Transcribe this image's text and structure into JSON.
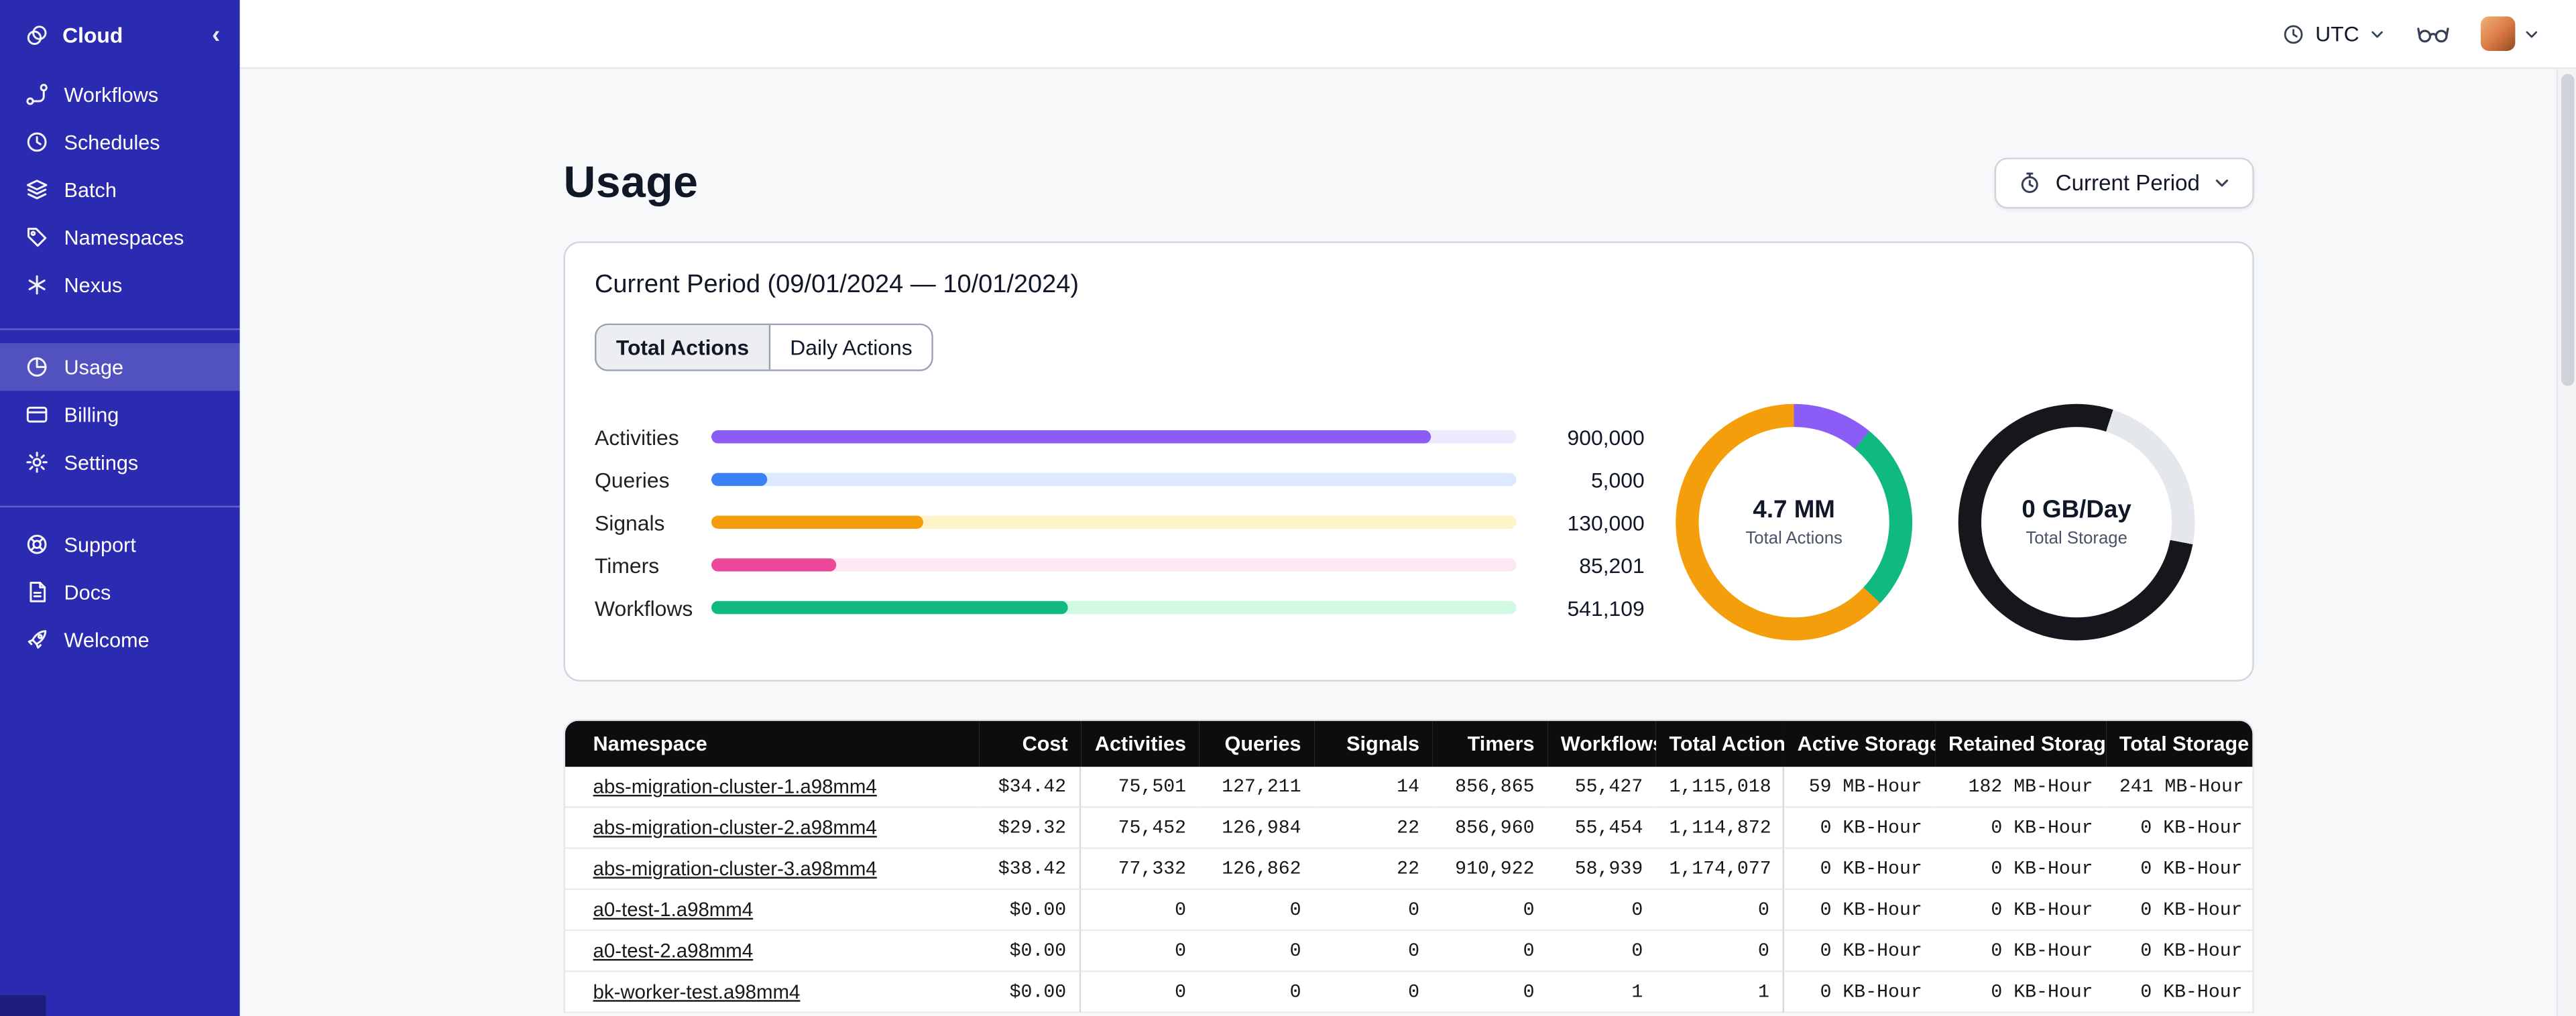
{
  "sidebar": {
    "brand_label": "Cloud",
    "groups": [
      {
        "items": [
          {
            "label": "Workflows",
            "icon": "workflows-icon",
            "active": false
          },
          {
            "label": "Schedules",
            "icon": "schedules-icon",
            "active": false
          },
          {
            "label": "Batch",
            "icon": "batch-icon",
            "active": false
          },
          {
            "label": "Namespaces",
            "icon": "namespaces-icon",
            "active": false
          },
          {
            "label": "Nexus",
            "icon": "nexus-icon",
            "active": false
          }
        ]
      },
      {
        "items": [
          {
            "label": "Usage",
            "icon": "usage-icon",
            "active": true
          },
          {
            "label": "Billing",
            "icon": "billing-icon",
            "active": false
          },
          {
            "label": "Settings",
            "icon": "settings-icon",
            "active": false
          }
        ]
      },
      {
        "items": [
          {
            "label": "Support",
            "icon": "support-icon",
            "active": false
          },
          {
            "label": "Docs",
            "icon": "docs-icon",
            "active": false
          },
          {
            "label": "Welcome",
            "icon": "welcome-icon",
            "active": false
          }
        ]
      }
    ]
  },
  "topbar": {
    "timezone": "UTC"
  },
  "page": {
    "title": "Usage",
    "period_button_label": "Current Period"
  },
  "usage_card": {
    "title": "Current Period (09/01/2024 — 10/01/2024)",
    "tabs": [
      {
        "label": "Total Actions",
        "active": true
      },
      {
        "label": "Daily Actions",
        "active": false
      }
    ],
    "chart_data": {
      "type": "bar",
      "categories": [
        "Activities",
        "Queries",
        "Signals",
        "Timers",
        "Workflows"
      ],
      "values": [
        900000,
        5000,
        130000,
        85201,
        541109
      ],
      "display_values": [
        "900,000",
        "5,000",
        "130,000",
        "85,201",
        "541,109"
      ],
      "percents": [
        89.4,
        7,
        26.3,
        15.5,
        44.3
      ],
      "colors": [
        "#8b5cf6",
        "#3b82f6",
        "#f59e0b",
        "#ec4899",
        "#10b981"
      ],
      "track_colors": [
        "#ede9fe",
        "#dbeafe",
        "#fef3c7",
        "#fce7f3",
        "#d1fae5"
      ]
    },
    "donuts": [
      {
        "value": "4.7 MM",
        "label": "Total Actions",
        "segments": [
          {
            "color": "#8b5cf6",
            "pct": 11
          },
          {
            "color": "#10b981",
            "pct": 26
          },
          {
            "color": "#f59e0b",
            "pct": 63
          }
        ]
      },
      {
        "value": "0 GB/Day",
        "label": "Total Storage",
        "segments": [
          {
            "color": "#16171d",
            "pct": 5
          },
          {
            "color": "#e4e7ec",
            "pct": 23
          },
          {
            "color": "#16171d",
            "pct": 72
          }
        ]
      }
    ]
  },
  "table": {
    "columns": [
      {
        "label": "Namespace",
        "align": "left"
      },
      {
        "label": "Cost",
        "align": "right",
        "divider_after": true
      },
      {
        "label": "Activities",
        "align": "right"
      },
      {
        "label": "Queries",
        "align": "right"
      },
      {
        "label": "Signals",
        "align": "right"
      },
      {
        "label": "Timers",
        "align": "right"
      },
      {
        "label": "Workflows",
        "align": "right"
      },
      {
        "label": "Total Actions",
        "align": "right",
        "divider_after": true
      },
      {
        "label": "Active Storage",
        "align": "right"
      },
      {
        "label": "Retained Storage",
        "align": "right"
      },
      {
        "label": "Total Storage",
        "align": "right"
      }
    ],
    "rows": [
      [
        "abs-migration-cluster-1.a98mm4",
        "$34.42",
        "75,501",
        "127,211",
        "14",
        "856,865",
        "55,427",
        "1,115,018",
        "59 MB-Hour",
        "182 MB-Hour",
        "241 MB-Hour"
      ],
      [
        "abs-migration-cluster-2.a98mm4",
        "$29.32",
        "75,452",
        "126,984",
        "22",
        "856,960",
        "55,454",
        "1,114,872",
        "0 KB-Hour",
        "0 KB-Hour",
        "0 KB-Hour"
      ],
      [
        "abs-migration-cluster-3.a98mm4",
        "$38.42",
        "77,332",
        "126,862",
        "22",
        "910,922",
        "58,939",
        "1,174,077",
        "0 KB-Hour",
        "0 KB-Hour",
        "0 KB-Hour"
      ],
      [
        "a0-test-1.a98mm4",
        "$0.00",
        "0",
        "0",
        "0",
        "0",
        "0",
        "0",
        "0 KB-Hour",
        "0 KB-Hour",
        "0 KB-Hour"
      ],
      [
        "a0-test-2.a98mm4",
        "$0.00",
        "0",
        "0",
        "0",
        "0",
        "0",
        "0",
        "0 KB-Hour",
        "0 KB-Hour",
        "0 KB-Hour"
      ],
      [
        "bk-worker-test.a98mm4",
        "$0.00",
        "0",
        "0",
        "0",
        "0",
        "1",
        "1",
        "0 KB-Hour",
        "0 KB-Hour",
        "0 KB-Hour"
      ]
    ]
  }
}
